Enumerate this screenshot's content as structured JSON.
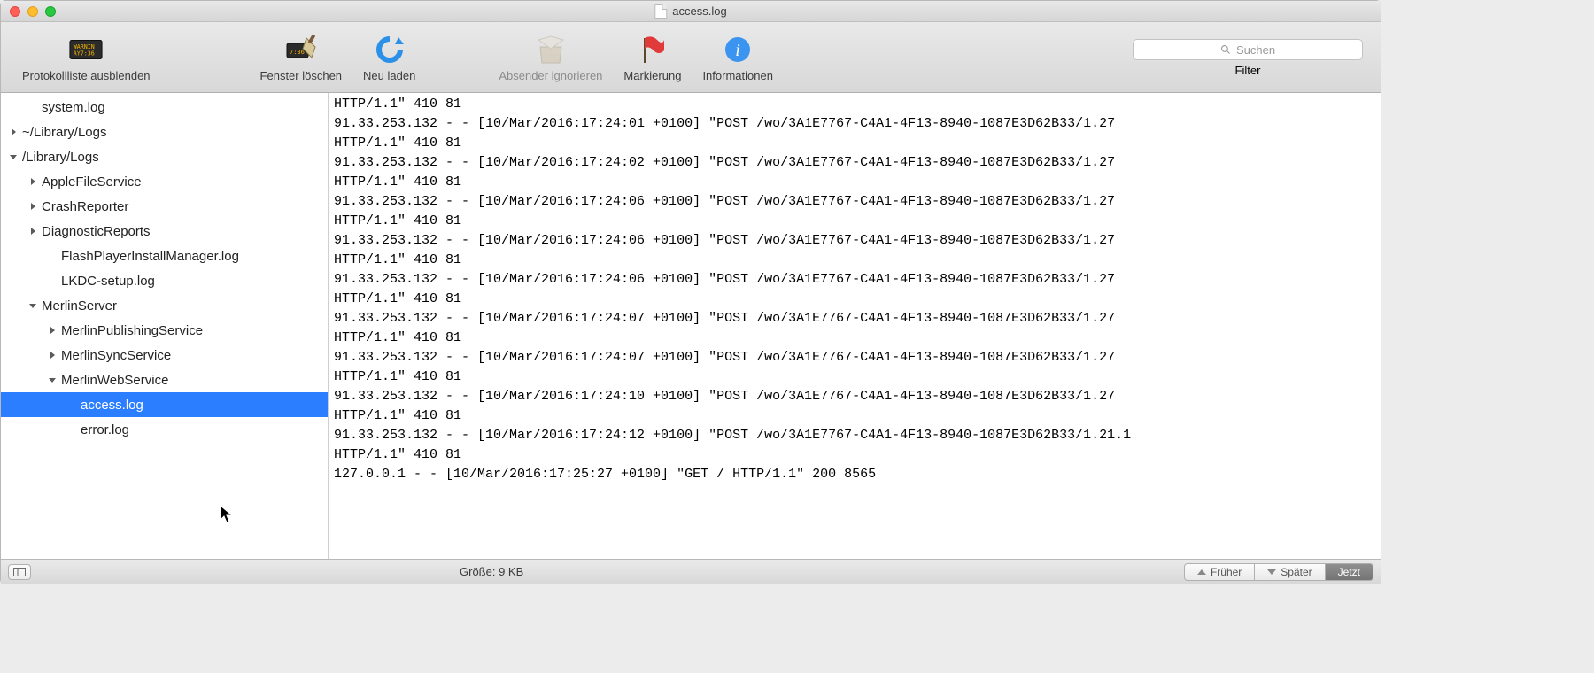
{
  "window": {
    "title": "access.log"
  },
  "toolbar": {
    "hide_list": "Protokollliste ausblenden",
    "clear": "Fenster löschen",
    "reload": "Neu laden",
    "ignore_sender": "Absender ignorieren",
    "mark": "Markierung",
    "info": "Informationen",
    "filter": "Filter",
    "search_placeholder": "Suchen"
  },
  "sidebar": {
    "items": [
      {
        "label": "system.log",
        "indent": 1,
        "arrow": "none"
      },
      {
        "label": "~/Library/Logs",
        "indent": 0,
        "arrow": "right"
      },
      {
        "label": "/Library/Logs",
        "indent": 0,
        "arrow": "down"
      },
      {
        "label": "AppleFileService",
        "indent": 1,
        "arrow": "right"
      },
      {
        "label": "CrashReporter",
        "indent": 1,
        "arrow": "right"
      },
      {
        "label": "DiagnosticReports",
        "indent": 1,
        "arrow": "right"
      },
      {
        "label": "FlashPlayerInstallManager.log",
        "indent": 2,
        "arrow": "none"
      },
      {
        "label": "LKDC-setup.log",
        "indent": 2,
        "arrow": "none"
      },
      {
        "label": "MerlinServer",
        "indent": 1,
        "arrow": "down"
      },
      {
        "label": "MerlinPublishingService",
        "indent": 2,
        "arrow": "right"
      },
      {
        "label": "MerlinSyncService",
        "indent": 2,
        "arrow": "right"
      },
      {
        "label": "MerlinWebService",
        "indent": 2,
        "arrow": "down"
      },
      {
        "label": "access.log",
        "indent": 3,
        "arrow": "none",
        "selected": true
      },
      {
        "label": "error.log",
        "indent": 3,
        "arrow": "none"
      }
    ]
  },
  "log_lines": [
    "HTTP/1.1\" 410 81",
    "91.33.253.132 - - [10/Mar/2016:17:24:01 +0100] \"POST /wo/3A1E7767-C4A1-4F13-8940-1087E3D62B33/1.27",
    "HTTP/1.1\" 410 81",
    "91.33.253.132 - - [10/Mar/2016:17:24:02 +0100] \"POST /wo/3A1E7767-C4A1-4F13-8940-1087E3D62B33/1.27",
    "HTTP/1.1\" 410 81",
    "91.33.253.132 - - [10/Mar/2016:17:24:06 +0100] \"POST /wo/3A1E7767-C4A1-4F13-8940-1087E3D62B33/1.27",
    "HTTP/1.1\" 410 81",
    "91.33.253.132 - - [10/Mar/2016:17:24:06 +0100] \"POST /wo/3A1E7767-C4A1-4F13-8940-1087E3D62B33/1.27",
    "HTTP/1.1\" 410 81",
    "91.33.253.132 - - [10/Mar/2016:17:24:06 +0100] \"POST /wo/3A1E7767-C4A1-4F13-8940-1087E3D62B33/1.27",
    "HTTP/1.1\" 410 81",
    "91.33.253.132 - - [10/Mar/2016:17:24:07 +0100] \"POST /wo/3A1E7767-C4A1-4F13-8940-1087E3D62B33/1.27",
    "HTTP/1.1\" 410 81",
    "91.33.253.132 - - [10/Mar/2016:17:24:07 +0100] \"POST /wo/3A1E7767-C4A1-4F13-8940-1087E3D62B33/1.27",
    "HTTP/1.1\" 410 81",
    "91.33.253.132 - - [10/Mar/2016:17:24:10 +0100] \"POST /wo/3A1E7767-C4A1-4F13-8940-1087E3D62B33/1.27",
    "HTTP/1.1\" 410 81",
    "91.33.253.132 - - [10/Mar/2016:17:24:12 +0100] \"POST /wo/3A1E7767-C4A1-4F13-8940-1087E3D62B33/1.21.1",
    "HTTP/1.1\" 410 81",
    "127.0.0.1 - - [10/Mar/2016:17:25:27 +0100] \"GET / HTTP/1.1\" 200 8565"
  ],
  "status": {
    "size_label": "Größe: 9 KB",
    "earlier": "Früher",
    "later": "Später",
    "now": "Jetzt"
  }
}
